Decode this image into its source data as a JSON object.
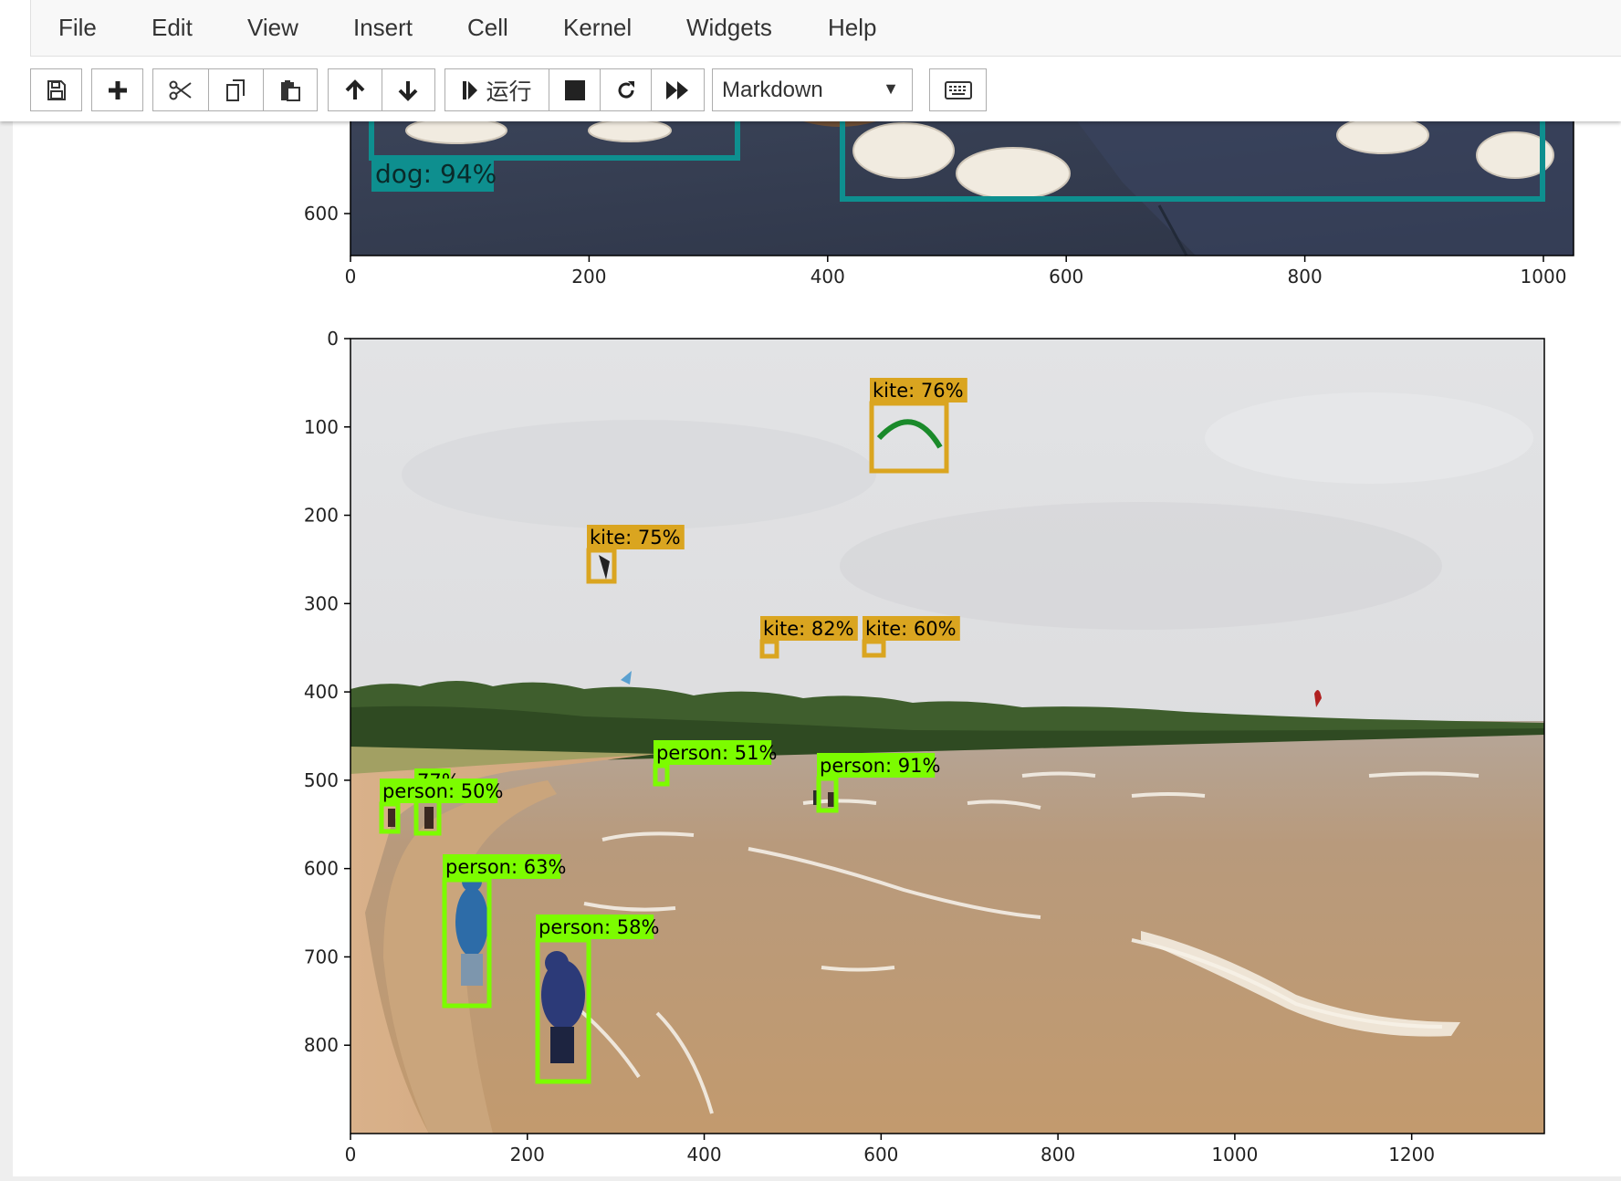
{
  "menu": {
    "items": [
      "File",
      "Edit",
      "View",
      "Insert",
      "Cell",
      "Kernel",
      "Widgets",
      "Help"
    ]
  },
  "toolbar": {
    "run_label": "运行",
    "cell_type": "Markdown",
    "icons": [
      "save-icon",
      "plus-icon",
      "cut-icon",
      "copy-icon",
      "paste-icon",
      "arrow-up-icon",
      "arrow-down-icon",
      "step-forward-icon",
      "stop-icon",
      "restart-icon",
      "fast-forward-icon",
      "keyboard-icon"
    ]
  },
  "plot1": {
    "x_ticks": [
      "0",
      "200",
      "400",
      "600",
      "800",
      "1000"
    ],
    "y_ticks": [
      "600"
    ],
    "label": "dog: 94%",
    "colors": {
      "box": "#0e8f8f",
      "label_bg": "#0e8f8f"
    }
  },
  "plot2": {
    "x_ticks": [
      "0",
      "200",
      "400",
      "600",
      "800",
      "1000",
      "1200"
    ],
    "y_ticks": [
      "0",
      "100",
      "200",
      "300",
      "400",
      "500",
      "600",
      "700",
      "800"
    ],
    "detections": [
      {
        "label": "kite: 76%",
        "class": "kite"
      },
      {
        "label": "kite: 75%",
        "class": "kite"
      },
      {
        "label": "kite: 82%",
        "class": "kite"
      },
      {
        "label": "kite: 60%",
        "class": "kite"
      },
      {
        "label": "person: 51%",
        "class": "person"
      },
      {
        "label": "person: 91%",
        "class": "person"
      },
      {
        "label": "77%",
        "class": "person"
      },
      {
        "label": "person: 50%",
        "class": "person"
      },
      {
        "label": "person: 63%",
        "class": "person"
      },
      {
        "label": "person: 58%",
        "class": "person"
      }
    ],
    "colors": {
      "kite": "#daa520",
      "person": "#7cfc00"
    }
  }
}
